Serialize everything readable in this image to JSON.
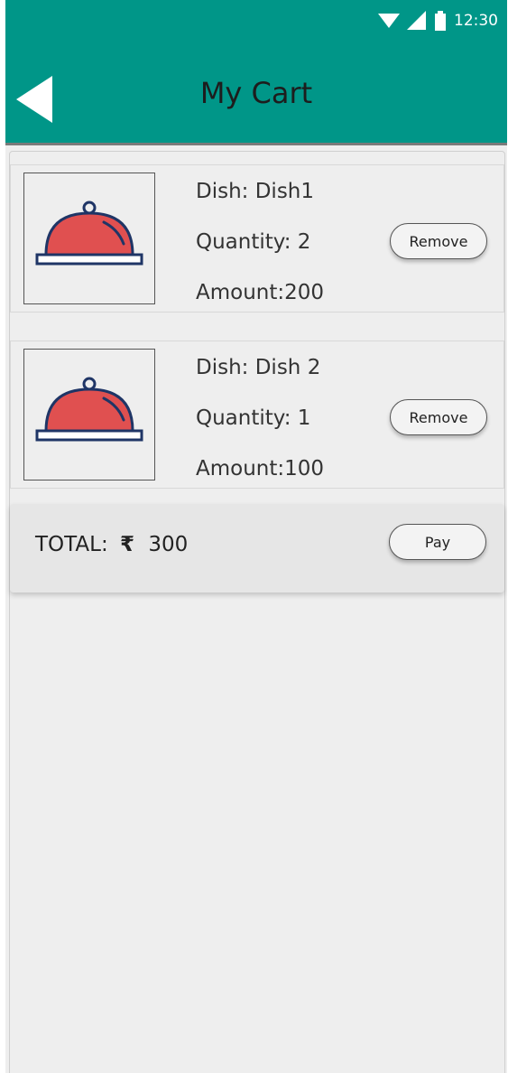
{
  "status_bar": {
    "time": "12:30",
    "icons": [
      "wifi-icon",
      "signal-icon",
      "battery-icon"
    ]
  },
  "app_bar": {
    "title": "My Cart",
    "back_icon": "back-arrow-icon"
  },
  "cart": {
    "items": [
      {
        "dish": "Dish: Dish1",
        "quantity": "Quantity: 2",
        "amount": "Amount:200",
        "remove_label": "Remove",
        "image_icon": "food-cloche-icon"
      },
      {
        "dish": "Dish: Dish 2",
        "quantity": "Quantity: 1",
        "amount": "Amount:100",
        "remove_label": "Remove",
        "image_icon": "food-cloche-icon"
      }
    ],
    "total_label": "TOTAL:",
    "currency_symbol": "₹",
    "total_value": "300",
    "pay_label": "Pay"
  },
  "colors": {
    "primary": "#009688",
    "cloche_red": "#e05050",
    "cloche_outline": "#1f3566",
    "background": "#eeeeee"
  }
}
